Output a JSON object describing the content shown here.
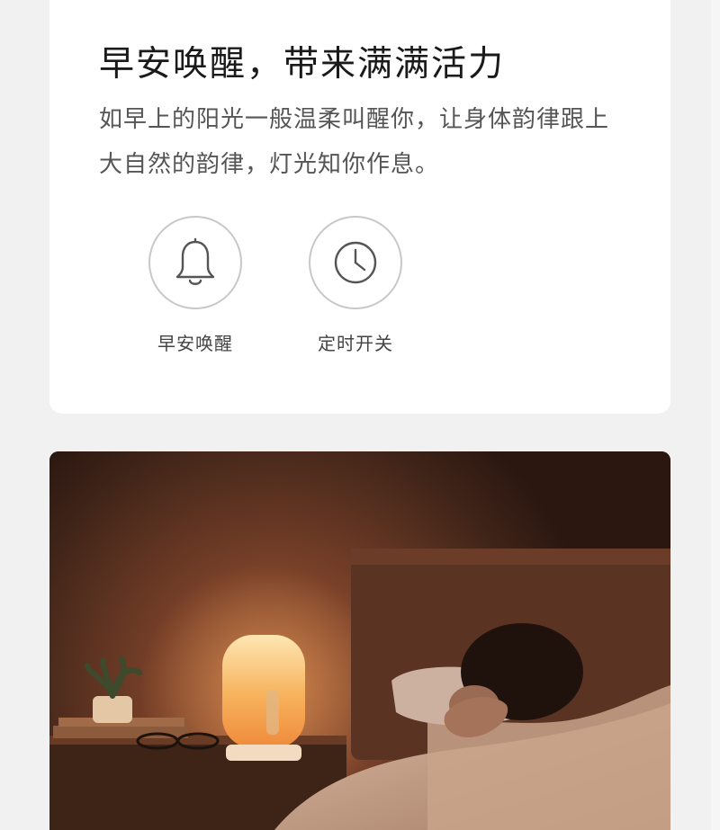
{
  "feature_card": {
    "headline": "早安唤醒，带来满满活力",
    "description": "如早上的阳光一般温柔叫醒你，让身体韵律跟上大自然的韵律，灯光知你作息。",
    "features": [
      {
        "icon": "bell-icon",
        "label": "早安唤醒"
      },
      {
        "icon": "clock-icon",
        "label": "定时开关"
      }
    ]
  },
  "photo": {
    "subject": "bedside lamp glowing beside sleeping person"
  },
  "colors": {
    "card_bg": "#ffffff",
    "page_bg": "#f1f1f1",
    "lamp_glow": "#f7b15a"
  }
}
